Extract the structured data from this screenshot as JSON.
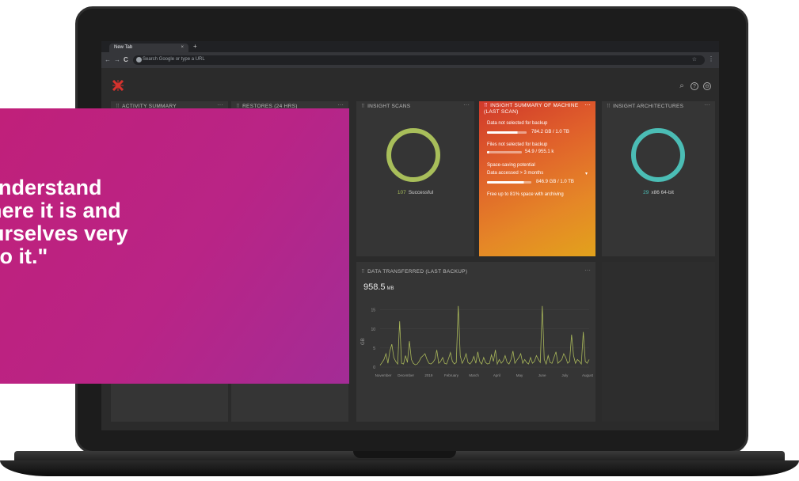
{
  "browser": {
    "tab_title": "New Tab",
    "tab_close": "×",
    "new_tab": "+",
    "nav_back": "←",
    "nav_forward": "→",
    "nav_reload": "C",
    "omnibox_placeholder": "Search Google or type a URL",
    "star": "☆",
    "menu": "⋮"
  },
  "header": {
    "search_icon": "⌕",
    "help_icon": "?",
    "account_icon": "⊖"
  },
  "cards": {
    "activity_summary": {
      "title": "ACTIVITY SUMMARY",
      "menu": "···"
    },
    "restores": {
      "title": "RESTORES (24 HRS)",
      "menu": "···"
    },
    "insight_scans": {
      "title": "INSIGHT SCANS",
      "menu": "···",
      "count": "107",
      "label": "Successful",
      "ring_color": "#a8be5a"
    },
    "insight_summary": {
      "title": "INSIGHT SUMMARY OF MACHINE (LAST SCAN)",
      "menu": "···",
      "items": [
        {
          "label": "Data not selected for backup",
          "value": "784.2 GB / 1.0 TB",
          "fill": 0.77
        },
        {
          "label": "Files not selected for backup",
          "value": "54.9 / 955.1 k",
          "fill": 0.06
        },
        {
          "label": "Space-saving potential"
        },
        {
          "label": "Data accessed > 3 months",
          "value": "846.9 GB / 1.0 TB",
          "fill": 0.83,
          "caret": "▾"
        },
        {
          "label": "Free up to 81% space with archiving"
        }
      ]
    },
    "insight_architectures": {
      "title": "INSIGHT ARCHITECTURES",
      "menu": "···",
      "count": "29",
      "label": "x86 64-bit",
      "ring_color": "#4bbdb5"
    },
    "data_transferred": {
      "title": "DATA TRANSFERRED (LAST BACKUP)",
      "menu": "···",
      "value": "958.5",
      "unit": "MB"
    }
  },
  "chart_data": {
    "type": "line",
    "ylabel": "GB",
    "ylim": [
      0,
      17
    ],
    "yticks": [
      "0",
      "5",
      "10",
      "15"
    ],
    "ytick_values": [
      0,
      5,
      10,
      15
    ],
    "x_labels": [
      "November",
      "December",
      "2019",
      "February",
      "March",
      "April",
      "May",
      "June",
      "July",
      "August"
    ],
    "series": [
      {
        "color": "#a9b75a",
        "values": [
          0.5,
          1.2,
          2.0,
          3.5,
          1.0,
          4.2,
          6.0,
          2.5,
          1.5,
          0.8,
          12.0,
          1.0,
          0.8,
          3.0,
          1.2,
          6.8,
          2.0,
          1.0,
          0.6,
          0.8,
          1.5,
          2.5,
          3.0,
          3.5,
          2.0,
          1.0,
          0.8,
          1.2,
          2.0,
          4.5,
          1.0,
          1.5,
          2.5,
          1.0,
          0.8,
          2.2,
          3.8,
          1.5,
          0.8,
          1.2,
          16.0,
          3.0,
          1.0,
          2.0,
          3.5,
          1.2,
          0.8,
          1.5,
          2.8,
          1.0,
          4.0,
          1.5,
          0.8,
          2.5,
          1.2,
          0.8,
          1.0,
          3.2,
          1.5,
          4.5,
          0.8,
          2.0,
          1.0,
          1.6,
          3.0,
          1.2,
          0.8,
          2.0,
          4.2,
          1.0,
          1.8,
          2.5,
          3.5,
          1.0,
          2.0,
          1.2,
          0.8,
          2.5,
          1.0,
          1.5,
          3.0,
          2.0,
          1.2,
          16.0,
          2.0,
          0.8,
          3.0,
          1.2,
          1.0,
          2.5,
          4.0,
          1.0,
          1.5,
          2.0,
          3.5,
          2.5,
          1.0,
          1.5,
          8.5,
          3.0,
          1.0,
          2.0,
          1.5,
          0.8,
          9.2,
          1.5,
          1.0,
          2.0
        ]
      }
    ]
  },
  "overlay": {
    "quote": "– to understand\nta, where it is and\nata ourselves very\nd to do it.\""
  }
}
